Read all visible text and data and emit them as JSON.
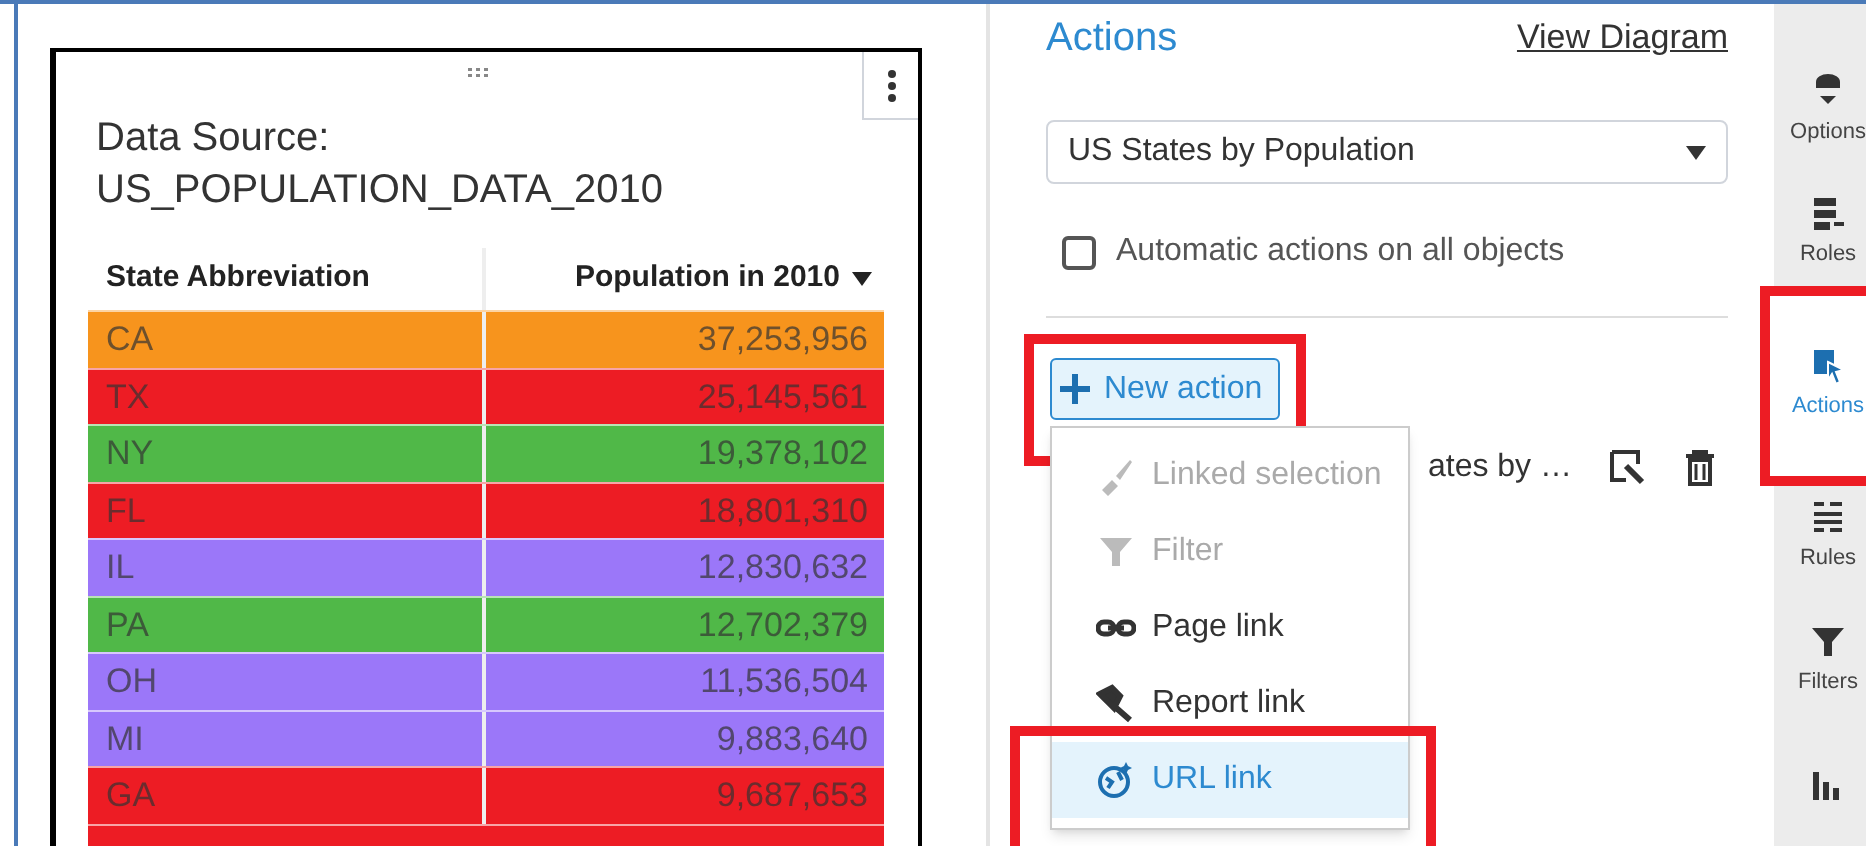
{
  "table_panel": {
    "title_lines": [
      "Data Source:",
      "US_POPULATION_DATA_2010"
    ],
    "columns": [
      {
        "label": "State Abbreviation",
        "sorted": false
      },
      {
        "label": "Population in 2010",
        "sorted": true
      }
    ],
    "rows": [
      {
        "cells": [
          "CA",
          "37,253,956"
        ],
        "color": "#f7941d"
      },
      {
        "cells": [
          "TX",
          "25,145,561"
        ],
        "color": "#ed1c24"
      },
      {
        "cells": [
          "NY",
          "19,378,102"
        ],
        "color": "#50b848"
      },
      {
        "cells": [
          "FL",
          "18,801,310"
        ],
        "color": "#ed1c24"
      },
      {
        "cells": [
          "IL",
          "12,830,632"
        ],
        "color": "#9b77f9"
      },
      {
        "cells": [
          "PA",
          "12,702,379"
        ],
        "color": "#50b848"
      },
      {
        "cells": [
          "OH",
          "11,536,504"
        ],
        "color": "#9b77f9"
      },
      {
        "cells": [
          "MI",
          "9,883,640"
        ],
        "color": "#9b77f9"
      },
      {
        "cells": [
          "GA",
          "9,687,653"
        ],
        "color": "#ed1c24"
      },
      {
        "color": "#ed1c24"
      }
    ]
  },
  "actions_panel": {
    "title": "Actions",
    "view_link": "View Diagram",
    "object_select": {
      "value": "US States by Population"
    },
    "auto_actions": {
      "label": "Automatic actions on all objects",
      "checked": false
    },
    "new_action": {
      "label": "New action",
      "highlighted": true
    },
    "existing_action": {
      "label": "ates by …"
    },
    "menu": [
      {
        "label": "Linked selection",
        "kind": "brush",
        "disabled": true,
        "selected": false,
        "highlighted": false
      },
      {
        "label": "Filter",
        "kind": "filter",
        "disabled": true,
        "selected": false,
        "highlighted": false
      },
      {
        "label": "Page link",
        "kind": "link",
        "disabled": false,
        "selected": false,
        "highlighted": false
      },
      {
        "label": "Report link",
        "kind": "report",
        "disabled": false,
        "selected": false,
        "highlighted": false
      },
      {
        "label": "URL link",
        "kind": "globe",
        "disabled": false,
        "selected": true,
        "highlighted": true
      }
    ]
  },
  "sidebar": [
    {
      "label": "Options",
      "kind": "options",
      "selected": false,
      "highlighted": false
    },
    {
      "label": "Roles",
      "kind": "roles",
      "selected": false,
      "highlighted": false
    },
    {
      "label": "Actions",
      "kind": "actions",
      "selected": true,
      "highlighted": true
    },
    {
      "label": "Rules",
      "kind": "rules",
      "selected": false,
      "highlighted": false
    },
    {
      "label": "Filters",
      "kind": "filters",
      "selected": false,
      "highlighted": false
    },
    {
      "kind": "chart",
      "selected": false,
      "highlighted": false
    }
  ]
}
